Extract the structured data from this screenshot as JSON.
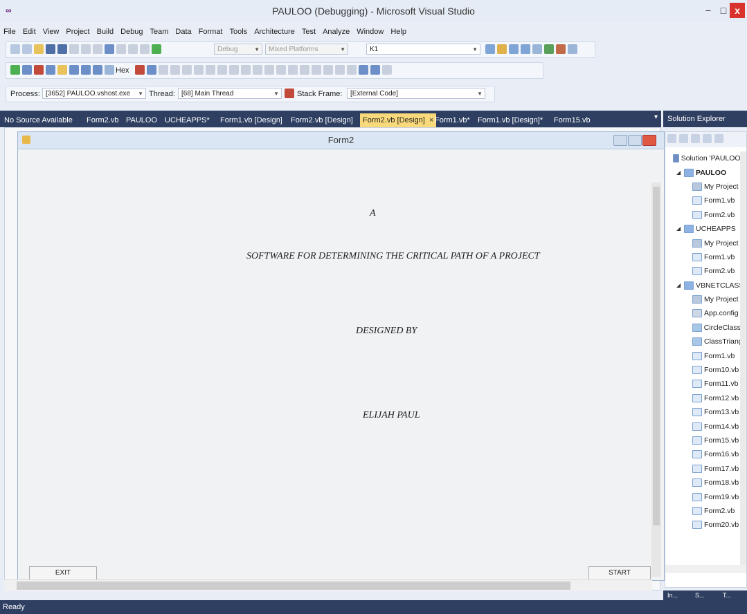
{
  "window": {
    "title": "PAULOO (Debugging) - Microsoft Visual Studio",
    "logo_text": "∞",
    "min": "−",
    "max": "□",
    "close": "x"
  },
  "menu": [
    "File",
    "Edit",
    "View",
    "Project",
    "Build",
    "Debug",
    "Team",
    "Data",
    "Format",
    "Tools",
    "Architecture",
    "Test",
    "Analyze",
    "Window",
    "Help"
  ],
  "toolbar": {
    "config_combo": "Debug",
    "platform_combo": "Mixed Platforms",
    "find_combo": "K1",
    "hex_label": "Hex",
    "process_label": "Process:",
    "process_value": "[3652] PAULOO.vshost.exe",
    "thread_label": "Thread:",
    "thread_value": "[68] Main Thread",
    "stack_label": "Stack Frame:",
    "stack_value": "[External Code]"
  },
  "tabs": [
    "No Source Available",
    "Form2.vb",
    "PAULOO",
    "UCHEAPPS*",
    "Form1.vb [Design]",
    "Form2.vb [Design]",
    "Form2.vb [Design]",
    "Form1.vb*",
    "Form1.vb [Design]*",
    "Form15.vb"
  ],
  "tab_close": "×",
  "form": {
    "title": "Form2",
    "line1": "A",
    "line2": "SOFTWARE FOR DETERMINING THE CRITICAL PATH OF A PROJECT",
    "line3": "DESIGNED BY",
    "line4": "ELIJAH PAUL",
    "exit_button": "EXIT",
    "start_button": "START"
  },
  "solution_explorer": {
    "header": "Solution Explorer",
    "header_pins": "▾ ⊞ ×",
    "items": [
      {
        "label": "Solution 'PAULOO' (",
        "indent": 0,
        "icon": "sol",
        "tri": ""
      },
      {
        "label": "PAULOO",
        "indent": 1,
        "icon": "proj",
        "tri": "◢",
        "bold": true
      },
      {
        "label": "My Project",
        "indent": 2,
        "icon": "my",
        "tri": ""
      },
      {
        "label": "Form1.vb",
        "indent": 2,
        "icon": "form",
        "tri": ""
      },
      {
        "label": "Form2.vb",
        "indent": 2,
        "icon": "form",
        "tri": ""
      },
      {
        "label": "UCHEAPPS",
        "indent": 1,
        "icon": "proj",
        "tri": "◢"
      },
      {
        "label": "My Project",
        "indent": 2,
        "icon": "my",
        "tri": ""
      },
      {
        "label": "Form1.vb",
        "indent": 2,
        "icon": "form",
        "tri": ""
      },
      {
        "label": "Form2.vb",
        "indent": 2,
        "icon": "form",
        "tri": ""
      },
      {
        "label": "VBNETCLASS",
        "indent": 1,
        "icon": "proj",
        "tri": "◢"
      },
      {
        "label": "My Project",
        "indent": 2,
        "icon": "my",
        "tri": ""
      },
      {
        "label": "App.config",
        "indent": 2,
        "icon": "cfg",
        "tri": ""
      },
      {
        "label": "CircleClass.v",
        "indent": 2,
        "icon": "cls",
        "tri": ""
      },
      {
        "label": "ClassTriangl",
        "indent": 2,
        "icon": "cls",
        "tri": ""
      },
      {
        "label": "Form1.vb",
        "indent": 2,
        "icon": "form",
        "tri": ""
      },
      {
        "label": "Form10.vb",
        "indent": 2,
        "icon": "form",
        "tri": ""
      },
      {
        "label": "Form11.vb",
        "indent": 2,
        "icon": "form",
        "tri": ""
      },
      {
        "label": "Form12.vb",
        "indent": 2,
        "icon": "form",
        "tri": ""
      },
      {
        "label": "Form13.vb",
        "indent": 2,
        "icon": "form",
        "tri": ""
      },
      {
        "label": "Form14.vb",
        "indent": 2,
        "icon": "form",
        "tri": ""
      },
      {
        "label": "Form15.vb",
        "indent": 2,
        "icon": "form",
        "tri": ""
      },
      {
        "label": "Form16.vb",
        "indent": 2,
        "icon": "form",
        "tri": ""
      },
      {
        "label": "Form17.vb",
        "indent": 2,
        "icon": "form",
        "tri": ""
      },
      {
        "label": "Form18.vb",
        "indent": 2,
        "icon": "form",
        "tri": ""
      },
      {
        "label": "Form19.vb",
        "indent": 2,
        "icon": "form",
        "tri": ""
      },
      {
        "label": "Form2.vb",
        "indent": 2,
        "icon": "form",
        "tri": ""
      },
      {
        "label": "Form20.vb",
        "indent": 2,
        "icon": "form",
        "tri": ""
      }
    ],
    "bottom_tabs": [
      "In...",
      "S...",
      "T..."
    ]
  },
  "status": {
    "text": "Ready"
  },
  "colors": {
    "accent": "#2f3f62",
    "active_tab": "#f9d97a",
    "close": "#d9322c"
  }
}
